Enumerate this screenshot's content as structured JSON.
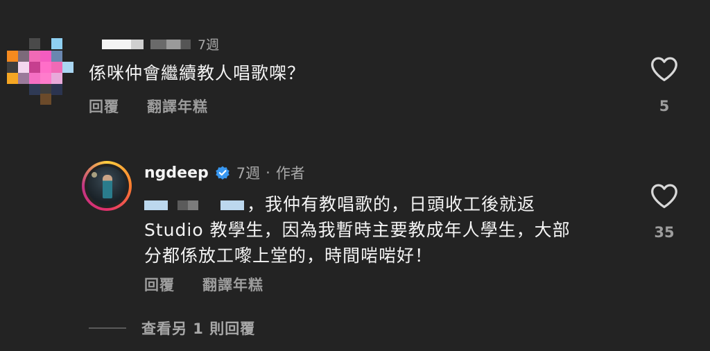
{
  "comment": {
    "timestamp": "7週",
    "text": "係咪仲會繼續教人唱歌㗎？",
    "reply_label": "回覆",
    "translate_label": "翻譯年糕",
    "like_count": "5"
  },
  "reply": {
    "username": "ngdeep",
    "timestamp": "7週",
    "separator": "·",
    "author_label": "作者",
    "text_line1": "，我仲有教唱歌的，日頭收工後就返",
    "text_line2": "Studio 教學生，因為我暫時主要教成年人學生，大部",
    "text_line3": "分都係放工嚟上堂的，時間啱啱好！",
    "reply_label": "回覆",
    "translate_label": "翻譯年糕",
    "like_count": "35"
  },
  "view_more_label": "查看另 1 則回覆",
  "colors": {
    "background": "#232323",
    "verified_blue": "#3897f0",
    "secondary_text": "#9d9d9d"
  }
}
